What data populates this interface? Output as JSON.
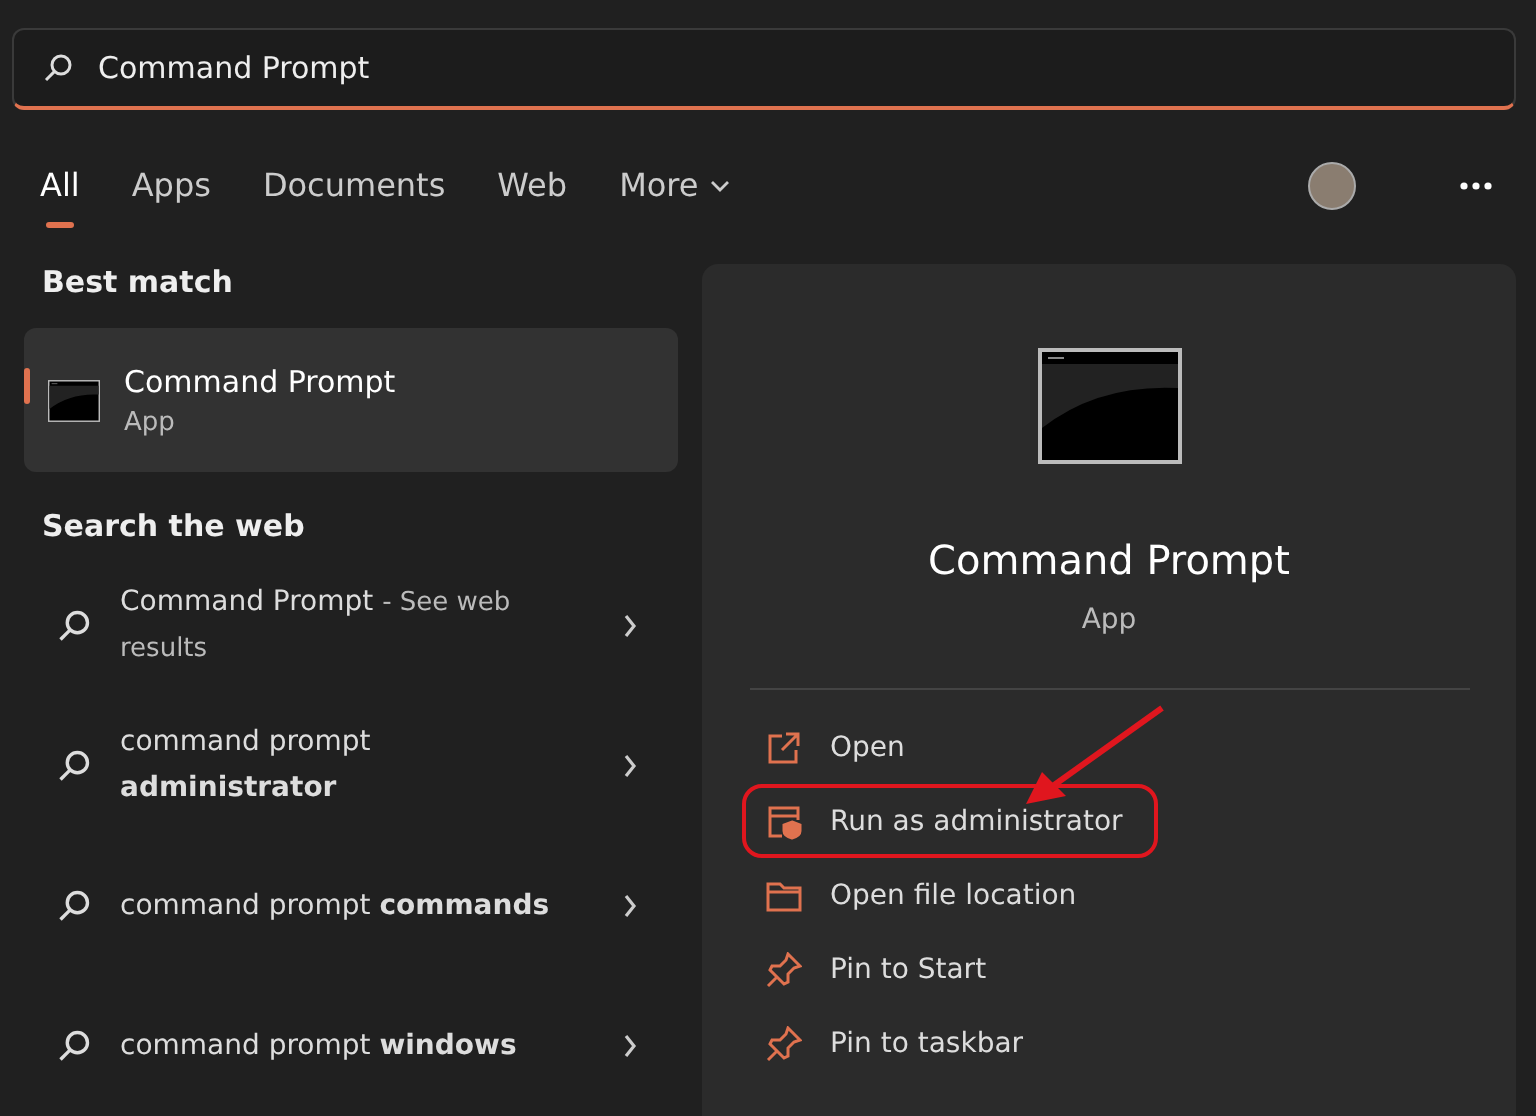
{
  "search": {
    "value": "Command Prompt"
  },
  "tabs": [
    {
      "label": "All",
      "selected": true,
      "dropdown": false
    },
    {
      "label": "Apps",
      "selected": false,
      "dropdown": false
    },
    {
      "label": "Documents",
      "selected": false,
      "dropdown": false
    },
    {
      "label": "Web",
      "selected": false,
      "dropdown": false
    },
    {
      "label": "More",
      "selected": false,
      "dropdown": true
    }
  ],
  "best_match": {
    "heading": "Best match",
    "title": "Command Prompt",
    "subtitle": "App",
    "selected": true
  },
  "web": {
    "heading": "Search the web",
    "results": [
      {
        "query": "Command Prompt",
        "suffix": "- See web results"
      },
      {
        "query": "command prompt **administrator**"
      },
      {
        "query": "command prompt **commands**"
      },
      {
        "query": "command prompt **windows**"
      }
    ]
  },
  "details": {
    "title": "Command Prompt",
    "subtitle": "App",
    "actions": [
      {
        "kind": "open",
        "label": "Open",
        "highlighted": false
      },
      {
        "kind": "admin",
        "label": "Run as administrator",
        "highlighted": true
      },
      {
        "kind": "folder",
        "label": "Open file location",
        "highlighted": false
      },
      {
        "kind": "pin",
        "label": "Pin to Start",
        "highlighted": false
      },
      {
        "kind": "pin",
        "label": "Pin to taskbar",
        "highlighted": false
      }
    ]
  }
}
